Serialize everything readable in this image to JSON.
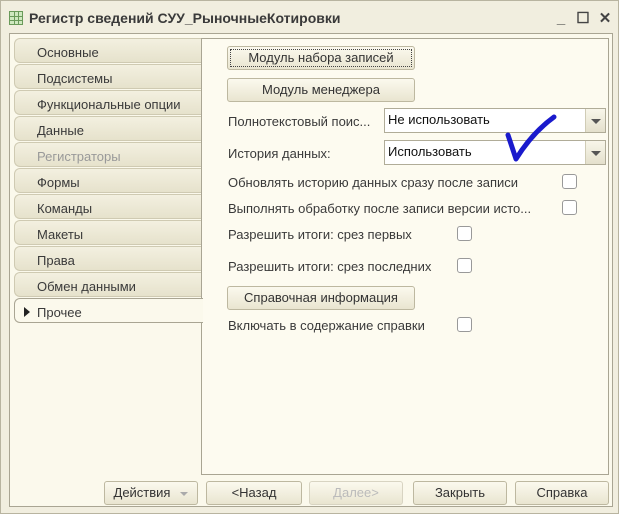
{
  "window": {
    "title": "Регистр сведений СУУ_РыночныеКотировки",
    "minimize": "_",
    "maximize": "☐",
    "close": "✕"
  },
  "tabs": [
    {
      "label": "Основные",
      "state": "normal"
    },
    {
      "label": "Подсистемы",
      "state": "normal"
    },
    {
      "label": "Функциональные опции",
      "state": "normal"
    },
    {
      "label": "Данные",
      "state": "normal"
    },
    {
      "label": "Регистраторы",
      "state": "disabled"
    },
    {
      "label": "Формы",
      "state": "normal"
    },
    {
      "label": "Команды",
      "state": "normal"
    },
    {
      "label": "Макеты",
      "state": "normal"
    },
    {
      "label": "Права",
      "state": "normal"
    },
    {
      "label": "Обмен данными",
      "state": "normal"
    },
    {
      "label": "Прочее",
      "state": "active"
    }
  ],
  "panel": {
    "record_set_module": "Модуль набора записей",
    "manager_module": "Модуль менеджера",
    "fulltext_label": "Полнотекстовый поис...",
    "fulltext_value": "Не использовать",
    "history_label": "История данных:",
    "history_value": "Использовать",
    "update_history_label": "Обновлять историю данных сразу после записи",
    "process_after_label": "Выполнять обработку после записи версии исто...",
    "totals_first_label": "Разрешить итоги: срез первых",
    "totals_last_label": "Разрешить итоги: срез последних",
    "help_info": "Справочная информация",
    "include_help_label": "Включать в содержание справки",
    "checkmark_color": "#1a1acc"
  },
  "footer": {
    "actions": "Действия",
    "back": "<Назад",
    "next": "Далее>",
    "close": "Закрыть",
    "help": "Справка"
  }
}
